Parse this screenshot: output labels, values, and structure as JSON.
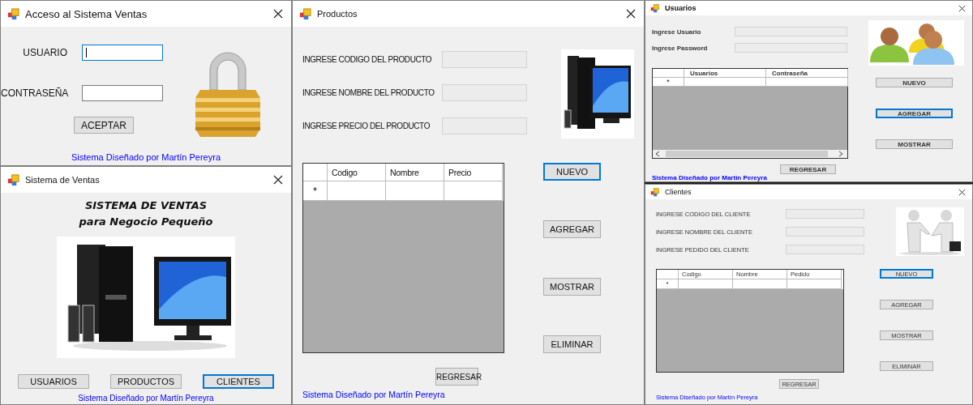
{
  "login": {
    "title": "Acceso al Sistema Ventas",
    "fields": [
      {
        "label": "USUARIO",
        "focused": true
      },
      {
        "label": "CONTRASEÑA",
        "focused": false
      }
    ],
    "button": "ACEPTAR",
    "credit": "Sistema Diseñado por Martín Pereyra"
  },
  "menu": {
    "title": "Sistema de Ventas",
    "heading": [
      "SISTEMA DE VENTAS",
      "para Negocio Pequeño"
    ],
    "buttons": [
      {
        "label": "USUARIOS",
        "focused": false
      },
      {
        "label": "PRODUCTOS",
        "focused": false
      },
      {
        "label": "CLIENTES",
        "focused": true
      }
    ],
    "credit": "Sistema Diseñado por Martín Pereyra"
  },
  "productos": {
    "title": "Productos",
    "fields": [
      "INGRESE CODIGO DEL PRODUCTO",
      "INGRESE NOMBRE DEL PRODUCTO",
      "INGRESE PRECIO DEL PRODUCTO"
    ],
    "table": {
      "columns": [
        "Codigo",
        "Nombre",
        "Precio"
      ],
      "new_row_marker": "*"
    },
    "buttons": [
      {
        "label": "NUEVO",
        "focused": true
      },
      {
        "label": "AGREGAR",
        "focused": false
      },
      {
        "label": "MOSTRAR",
        "focused": false
      },
      {
        "label": "ELIMINAR",
        "focused": false
      }
    ],
    "back_button": "REGRESAR",
    "credit": "Sistema Diseñado por Martín Pereyra"
  },
  "usuarios": {
    "title": "Usuarios",
    "fields": [
      "Ingrese Usuario",
      "Ingrese Password"
    ],
    "table": {
      "columns": [
        "Usuarios",
        "Contraseña"
      ],
      "new_row_marker": "*"
    },
    "buttons": [
      {
        "label": "NUEVO",
        "focused": false
      },
      {
        "label": "AGREGAR",
        "focused": true
      },
      {
        "label": "MOSTRAR",
        "focused": false
      }
    ],
    "back_button": "REGRESAR",
    "credit": "Sistema Diseñado por Martín Pereyra"
  },
  "clientes": {
    "title": "Clientes",
    "fields": [
      "INGRESE CODIGO DEL CLIENTE",
      "INGRESE NOMBRE DEL CLIENTE",
      "INGRESE PEDIDO DEL CLIENTE"
    ],
    "table": {
      "columns": [
        "Codigo",
        "Nombre",
        "Pedido"
      ],
      "new_row_marker": "*"
    },
    "buttons": [
      {
        "label": "NUEVO",
        "focused": true
      },
      {
        "label": "AGREGAR",
        "focused": false
      },
      {
        "label": "MOSTRAR",
        "focused": false
      },
      {
        "label": "ELIMINAR",
        "focused": false
      }
    ],
    "back_button": "REGRESAR",
    "credit": "Sistema Diseñado por Martín Pereyra"
  }
}
